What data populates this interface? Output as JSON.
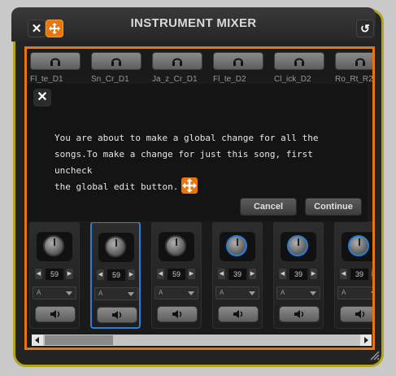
{
  "window": {
    "title": "INSTRUMENT MIXER"
  },
  "toolbar": {
    "close_icon": "close-icon",
    "global_edit_icon": "global-edit-icon",
    "reset_icon": "undo-icon"
  },
  "channels": [
    {
      "name": "Fl_te_D1",
      "value": "59",
      "select": "A",
      "selected": false
    },
    {
      "name": "Sn_Cr_D1",
      "value": "59",
      "select": "A",
      "selected": true
    },
    {
      "name": "Ja_z_Cr_D1",
      "value": "59",
      "select": "A",
      "selected": false
    },
    {
      "name": "Fl_te_D2",
      "value": "39",
      "select": "A",
      "selected": false
    },
    {
      "name": "Cl_ick_D2",
      "value": "39",
      "select": "A",
      "selected": false
    },
    {
      "name": "Ro_Rt_R2",
      "value": "39",
      "select": "A",
      "selected": false
    }
  ],
  "dialog": {
    "line1": "You are about to make a global change for all the",
    "line2": "songs.To make a change for just this song, first uncheck",
    "line3": "the global edit button.",
    "cancel_label": "Cancel",
    "continue_label": "Continue"
  },
  "colors": {
    "accent": "#e8760f",
    "frame": "#b5a51e",
    "selected": "#2a7fd4"
  }
}
